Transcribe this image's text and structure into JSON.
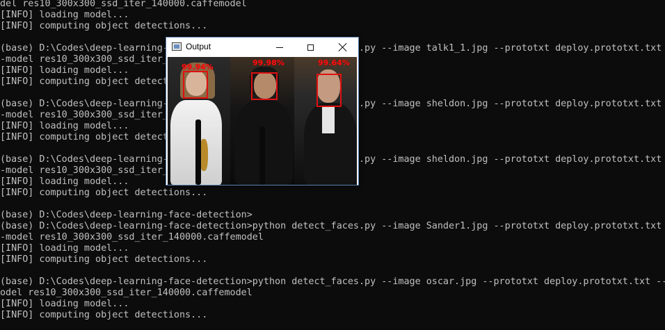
{
  "console": {
    "lines": [
      "del res10_300x300_ssd_iter_140000.caffemodel",
      "[INFO] loading model...",
      "[INFO] computing object detections...",
      "",
      "(base) D:\\Codes\\deep-learning-face-detection>python detect_faces.py --image talk1_1.jpg --prototxt deploy.prototxt.txt -",
      "-model res10_300x300_ssd_iter_140000.caffemodel",
      "[INFO] loading model...",
      "[INFO] computing object detections...",
      "",
      "(base) D:\\Codes\\deep-learning-face-detection>python detect_faces.py --image sheldon.jpg --prototxt deploy.prototxt.txt -",
      "-model res10_300x300_ssd_iter_140000.caffemodel",
      "[INFO] loading model...",
      "[INFO] computing object detections...",
      "",
      "(base) D:\\Codes\\deep-learning-face-detection>python detect_faces.py --image sheldon.jpg --prototxt deploy.prototxt.txt -",
      "-model res10_300x300_ssd_iter_140000.caffemodel",
      "[INFO] loading model...",
      "[INFO] computing object detections...",
      "",
      "(base) D:\\Codes\\deep-learning-face-detection>",
      "(base) D:\\Codes\\deep-learning-face-detection>python detect_faces.py --image Sander1.jpg --prototxt deploy.prototxt.txt -",
      "-model res10_300x300_ssd_iter_140000.caffemodel",
      "[INFO] loading model...",
      "[INFO] computing object detections...",
      "",
      "(base) D:\\Codes\\deep-learning-face-detection>python detect_faces.py --image oscar.jpg --prototxt deploy.prototxt.txt --m",
      "odel res10_300x300_ssd_iter_140000.caffemodel",
      "[INFO] loading model...",
      "[INFO] computing object detections..."
    ]
  },
  "window": {
    "title": "Output",
    "icon": "app-window-icon",
    "controls": [
      "minimize-icon",
      "maximize-icon",
      "close-icon"
    ]
  },
  "detections": [
    {
      "label": "99.94%"
    },
    {
      "label": "99.98%"
    },
    {
      "label": "99.64%"
    }
  ],
  "colors": {
    "console_bg": "#0c0c0c",
    "console_text": "#c0c0c0",
    "detection_box": "#e01010",
    "detection_label": "#ff1010"
  }
}
